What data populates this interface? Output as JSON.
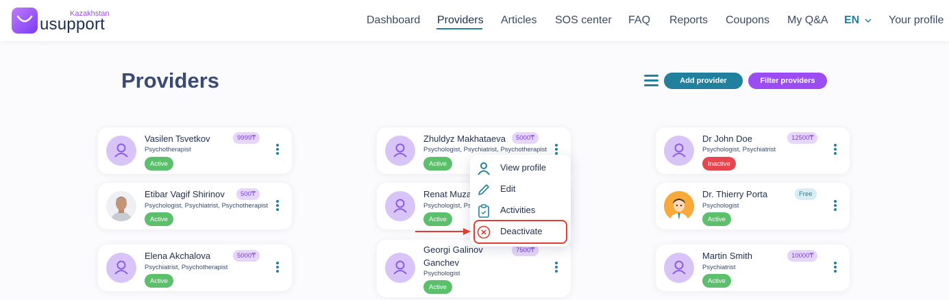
{
  "brand": {
    "country": "Kazakhstan",
    "name": "usupport"
  },
  "nav": [
    {
      "label": "Dashboard"
    },
    {
      "label": "Providers"
    },
    {
      "label": "Articles"
    },
    {
      "label": "SOS center"
    },
    {
      "label": "FAQ"
    },
    {
      "label": "Reports"
    },
    {
      "label": "Coupons"
    },
    {
      "label": "My Q&A"
    },
    {
      "label": "EN"
    },
    {
      "label": "Your profile"
    }
  ],
  "page": {
    "title": "Providers",
    "add_button": "Add provider",
    "filter_button": "Filter providers"
  },
  "providers": [
    {
      "name": "Vasilen Tsvetkov",
      "roles": "Psychotherapist",
      "price": "9999₸",
      "status": "Active"
    },
    {
      "name": "Etibar Vagif Shirinov",
      "roles": "Psychologist, Psychiatrist, Psychotherapist",
      "price": "500₸",
      "status": "Active"
    },
    {
      "name": "Elena Akchalova",
      "roles": "Psychiatrist, Psychotherapist",
      "price": "5000₸",
      "status": "Active"
    },
    {
      "name": "Zhuldyz Makhataeva",
      "roles": "Psychologist, Psychiatrist, Psychotherapist",
      "price": "5000₸",
      "status": "Active"
    },
    {
      "name": "Renat Muzaf",
      "roles": "Psychologist, Ps",
      "price": "",
      "status": "Active"
    },
    {
      "name": "Georgi Galinov Ganchev",
      "roles": "Psychologist",
      "price": "7500₸",
      "status": "Active"
    },
    {
      "name": "Dr John Doe",
      "roles": "Psychologist, Psychiatrist",
      "price": "12500₸",
      "status": "Inactive"
    },
    {
      "name": "Dr. Thierry Porta",
      "roles": "Psychologist",
      "price": "Free",
      "status": "Active"
    },
    {
      "name": "Martin Smith",
      "roles": "Psychiatrist",
      "price": "10000₸",
      "status": "Active"
    }
  ],
  "menu": [
    {
      "label": "View profile",
      "icon": "person-icon"
    },
    {
      "label": "Edit",
      "icon": "pencil-icon"
    },
    {
      "label": "Activities",
      "icon": "clipboard-icon"
    },
    {
      "label": "Deactivate",
      "icon": "close-circle-icon"
    }
  ],
  "colors": {
    "primary": "#20809e",
    "accent": "#9b4cf2",
    "active": "#5cbf6b",
    "inactive": "#e6474f",
    "highlight": "#e23a2e"
  }
}
